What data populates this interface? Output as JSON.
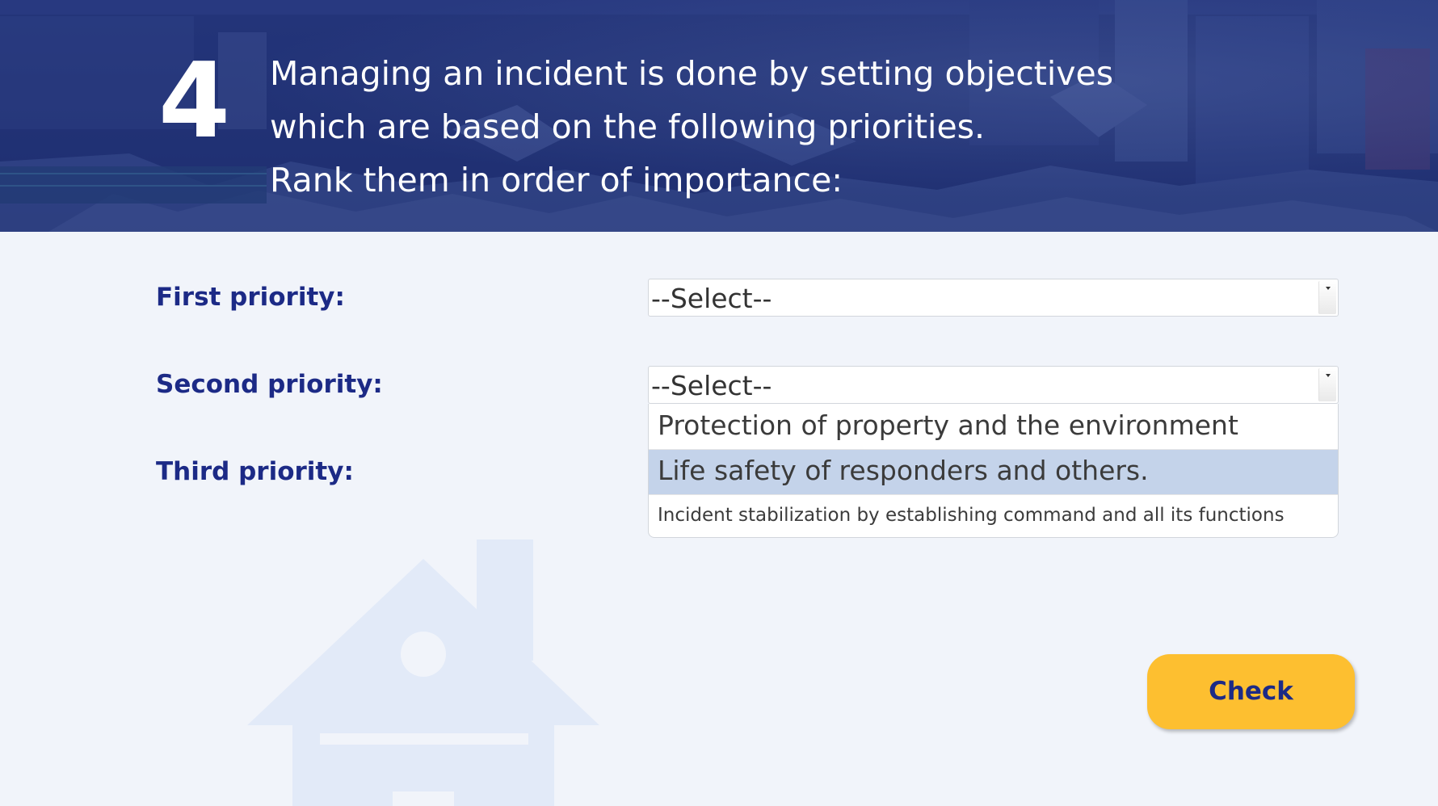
{
  "header": {
    "question_number": "4",
    "question_lines": [
      "Managing an incident is done by setting objectives",
      "which are based on the following priorities.",
      "Rank them in order of importance:"
    ]
  },
  "form": {
    "rows": [
      {
        "label": "First priority:",
        "selected": "--Select--"
      },
      {
        "label": "Second priority:",
        "selected": "--Select--"
      },
      {
        "label": "Third priority:"
      }
    ],
    "open_dropdown": {
      "options": [
        "Protection of property and the environment",
        "Life safety of responders and others.",
        "Incident stabilization by establishing command and all its functions"
      ],
      "highlighted_option": "Life safety of responders and others."
    }
  },
  "actions": {
    "check_label": "Check"
  },
  "colors": {
    "header_bg": "#1f2f6f",
    "page_bg": "#f1f4fa",
    "label_text": "#1c2a86",
    "button_bg": "#fdbf30",
    "highlight_bg": "#c4d3ea",
    "house_watermark": "#e2eaf8"
  },
  "icons": {
    "watermark": "house-icon",
    "select_arrow": "caret-down-icon"
  }
}
